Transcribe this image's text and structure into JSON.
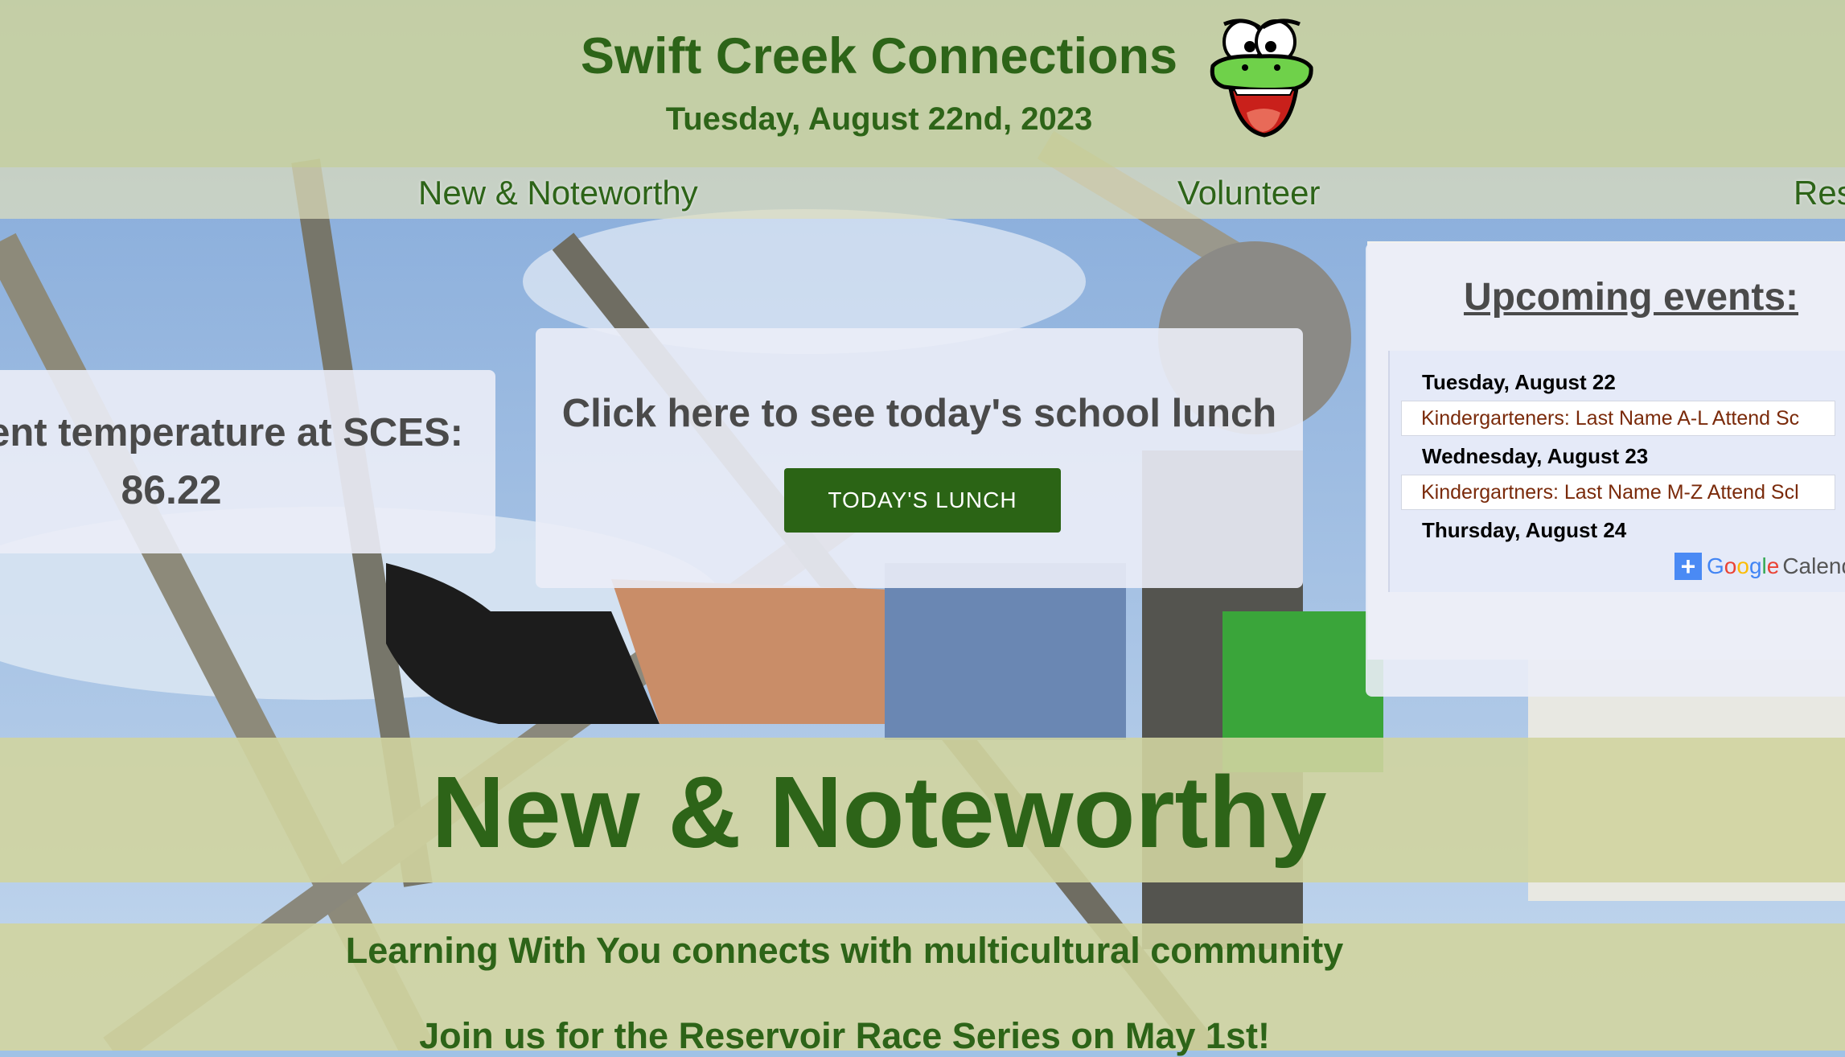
{
  "header": {
    "title": "Swift Creek Connections",
    "date": "Tuesday, August 22nd, 2023",
    "logo_icon": "gator-mascot-icon"
  },
  "nav": {
    "items": [
      "New & Noteworthy",
      "Volunteer",
      "Res"
    ]
  },
  "temperature": {
    "label": "ent temperature at SCES:",
    "value": "86.22"
  },
  "lunch": {
    "prompt": "Click here to see today's school lunch",
    "button_label": "TODAY'S LUNCH"
  },
  "events": {
    "title": "Upcoming events:",
    "calendar": {
      "days": [
        {
          "date": "Tuesday, August 22",
          "events": [
            "Kindergarteners: Last Name A-L Attend Sc"
          ]
        },
        {
          "date": "Wednesday, August 23",
          "events": [
            "Kindergartners: Last Name M-Z Attend Scl"
          ]
        },
        {
          "date": "Thursday, August 24",
          "events": []
        }
      ],
      "add_button": {
        "plus": "+",
        "brand": "Google",
        "product": "Calenda"
      }
    }
  },
  "section": {
    "title": "New & Noteworthy"
  },
  "news": {
    "items": [
      "Learning With You connects with multicultural community",
      "Join us for the Reservoir Race Series on May 1st!"
    ]
  },
  "colors": {
    "brand_green": "#2d6418",
    "button_green": "#2b6415",
    "header_tint": "#cdd49e",
    "card_bg": "#ebedf7",
    "google_blue": "#4285f4"
  }
}
